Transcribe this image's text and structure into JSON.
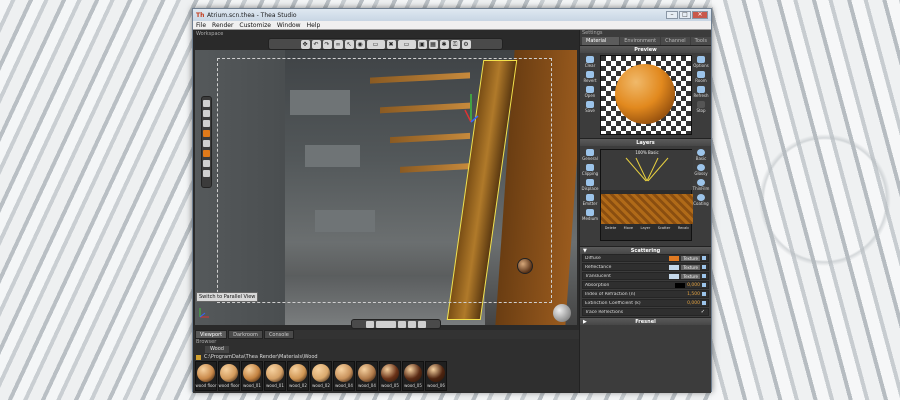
{
  "window": {
    "title": "Atrium.scn.thea - Thea Studio",
    "menu": [
      "File",
      "Render",
      "Customize",
      "Window",
      "Help"
    ]
  },
  "viewport": {
    "label": "Workspace",
    "tooltip": "Switch to Parallel View",
    "tabs": [
      "Viewport",
      "Darkroom",
      "Console"
    ]
  },
  "browser": {
    "label": "Browser",
    "tab": "Wood",
    "path": "C:\\ProgramData\\Thea Render\\Materials\\Wood",
    "thumbnails": [
      {
        "label": "wood floor",
        "color": "#c9894a"
      },
      {
        "label": "wood floor",
        "color": "#d29a5c"
      },
      {
        "label": "wood_01",
        "color": "#c38240"
      },
      {
        "label": "wood_01",
        "color": "#d4a066"
      },
      {
        "label": "wood_02",
        "color": "#cf9553"
      },
      {
        "label": "wood_02",
        "color": "#d9a86c"
      },
      {
        "label": "wood_04",
        "color": "#c8925c"
      },
      {
        "label": "wood_04",
        "color": "#b07a4a"
      },
      {
        "label": "wood_05",
        "color": "#6a3218"
      },
      {
        "label": "wood_05",
        "color": "#5a2a14"
      },
      {
        "label": "wood_06",
        "color": "#4e2410"
      }
    ]
  },
  "settings": {
    "label": "Settings",
    "tabs": [
      "Material Lab",
      "Environment",
      "Channel",
      "Tools"
    ],
    "preview": {
      "title": "Preview",
      "left_buttons": [
        "Clear",
        "Revert",
        "Open",
        "Save"
      ],
      "right_buttons": [
        "Options",
        "Room",
        "Refresh",
        "Stop"
      ]
    },
    "layers": {
      "title": "Layers",
      "layer_label": "100% Basic",
      "left_buttons": [
        "General",
        "Clipping",
        "Displace",
        "Emitter",
        "Medium"
      ],
      "right_buttons": [
        "Basic",
        "Glossy",
        "ThinFilm",
        "Coating"
      ],
      "bottom_buttons": [
        "Delete",
        "Move",
        "Layer",
        "Scatter",
        "Recalc"
      ]
    },
    "scattering": {
      "title": "Scattering",
      "rows": [
        {
          "name": "Diffuse",
          "swatch": "#e07a22",
          "texture": "Texture",
          "value": ""
        },
        {
          "name": "Reflectance",
          "swatch": "#c5d8ea",
          "texture": "Texture",
          "value": ""
        },
        {
          "name": "Translucent",
          "swatch": "#c5d8ea",
          "texture": "Texture",
          "value": ""
        },
        {
          "name": "Absorption",
          "swatch": "#000000",
          "texture": "",
          "value": "0,000"
        },
        {
          "name": "Index of Refraction (n)",
          "swatch": "",
          "texture": "",
          "value": "1,500"
        },
        {
          "name": "Extinction Coefficient (k)",
          "swatch": "",
          "texture": "",
          "value": "0,000"
        },
        {
          "name": "Trace Reflections",
          "swatch": "",
          "texture": "",
          "value": "",
          "check": "✓"
        }
      ]
    },
    "fresnel": {
      "title": "Fresnel"
    }
  }
}
